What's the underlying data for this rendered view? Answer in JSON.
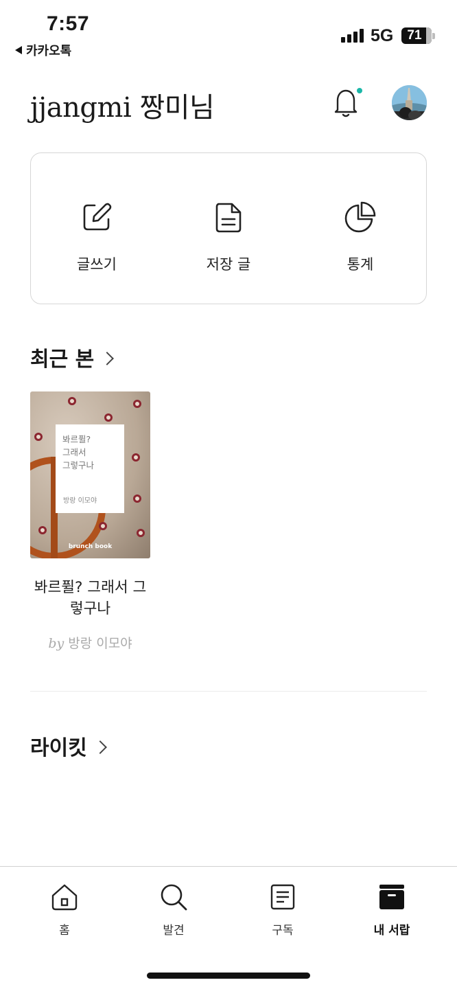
{
  "status": {
    "time": "7:57",
    "back_app": "카카오톡",
    "network": "5G",
    "battery": "71",
    "battery_level": 0.71
  },
  "header": {
    "greeting": "jjangmi 짱미님",
    "bell_icon": "bell-icon",
    "bell_dot_color": "#1bb7a8"
  },
  "actions": [
    {
      "label": "글쓰기",
      "icon": "pencil-square-icon"
    },
    {
      "label": "저장 글",
      "icon": "document-icon"
    },
    {
      "label": "통계",
      "icon": "pie-chart-icon"
    }
  ],
  "recent": {
    "heading": "최근 본",
    "book": {
      "cover_title": "봐르퓔?\n그래서\n그렇구나",
      "cover_author": "방랑 이모야",
      "cover_brand": "brunch book",
      "title": "봐르퓔? 그래서 그렇구나",
      "by": "by",
      "author": "방랑 이모야"
    }
  },
  "likeit": {
    "heading": "라이킷"
  },
  "tabbar": {
    "items": [
      {
        "label": "홈",
        "icon": "home-icon"
      },
      {
        "label": "발견",
        "icon": "search-icon"
      },
      {
        "label": "구독",
        "icon": "document-list-icon"
      },
      {
        "label": "내 서랍",
        "icon": "drawer-icon",
        "active": true
      }
    ]
  }
}
